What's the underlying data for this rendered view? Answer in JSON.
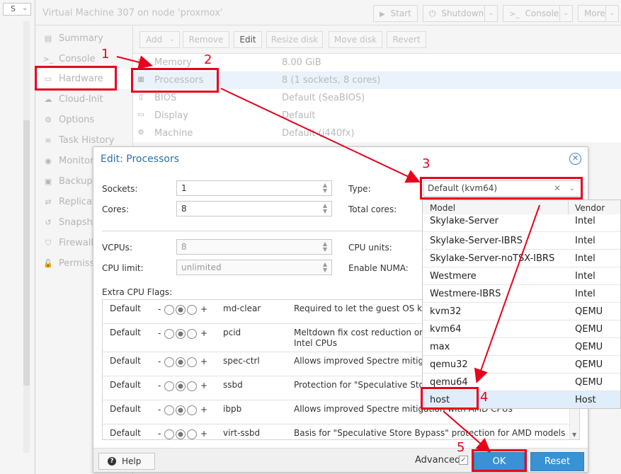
{
  "left_strip": {
    "select_value": "S",
    "select_caret": "⌄"
  },
  "header": {
    "title": "Virtual Machine 307 on node 'proxmox'",
    "buttons": [
      {
        "icon": "play-icon",
        "glyph": "▶",
        "label": "Start"
      },
      {
        "icon": "power-icon",
        "glyph": "⏻",
        "label": "Shutdown"
      },
      {
        "icon": "terminal-icon",
        "glyph": ">_",
        "label": "Console"
      },
      {
        "label": "More"
      }
    ]
  },
  "nav": {
    "items": [
      {
        "label": "Summary",
        "icon": "summary-icon",
        "glyph": "▤"
      },
      {
        "label": "Console",
        "icon": "terminal-icon",
        "glyph": ">_"
      },
      {
        "label": "Hardware",
        "icon": "monitor-icon",
        "glyph": "▭"
      },
      {
        "label": "Cloud-Init",
        "icon": "cloud-icon",
        "glyph": "☁"
      },
      {
        "label": "Options",
        "icon": "gear-icon",
        "glyph": "⚙"
      },
      {
        "label": "Task History",
        "icon": "list-icon",
        "glyph": "≡"
      },
      {
        "label": "Monitor",
        "icon": "eye-icon",
        "glyph": "◉"
      },
      {
        "label": "Backup",
        "icon": "floppy-icon",
        "glyph": "▣"
      },
      {
        "label": "Replicat",
        "icon": "retweet-icon",
        "glyph": "⇄"
      },
      {
        "label": "Snapsho",
        "icon": "history-icon",
        "glyph": "↺"
      },
      {
        "label": "Firewall",
        "icon": "shield-icon",
        "glyph": "⛉"
      },
      {
        "label": "Permiss",
        "icon": "unlock-icon",
        "glyph": "🔓"
      }
    ]
  },
  "toolbar": {
    "add_label": "Add",
    "remove_label": "Remove",
    "edit_label": "Edit",
    "resize_label": "Resize disk",
    "move_label": "Move disk",
    "revert_label": "Revert"
  },
  "hardware": [
    {
      "name": "Memory",
      "value": "8.00 GiB",
      "icon": "memory-icon",
      "glyph": "▥"
    },
    {
      "name": "Processors",
      "value": "8 (1 sockets, 8 cores)",
      "icon": "cpu-icon",
      "glyph": "▦"
    },
    {
      "name": "BIOS",
      "value": "Default (SeaBIOS)",
      "icon": "chip-icon",
      "glyph": "▯"
    },
    {
      "name": "Display",
      "value": "Default",
      "icon": "desktop-icon",
      "glyph": "▭"
    },
    {
      "name": "Machine",
      "value": "Default (i440fx)",
      "icon": "cogs-icon",
      "glyph": "⚙"
    }
  ],
  "dialog": {
    "title": "Edit: Processors",
    "close_glyph": "✕",
    "sockets_label": "Sockets:",
    "sockets_value": "1",
    "cores_label": "Cores:",
    "cores_value": "8",
    "type_label": "Type:",
    "type_value": "Default (kvm64)",
    "total_cores_label": "Total cores:",
    "vcpus_label": "VCPUs:",
    "vcpus_value": "8",
    "cpu_units_label": "CPU units:",
    "cpu_limit_label": "CPU limit:",
    "cpu_limit_value": "unlimited",
    "numa_label": "Enable NUMA:",
    "flags_label": "Extra CPU Flags:",
    "flags": [
      {
        "state": "Default",
        "name": "md-clear",
        "desc": "Required to let the guest OS kn"
      },
      {
        "state": "Default",
        "name": "pcid",
        "desc": "Meltdown fix cost reduction on V\nIntel CPUs"
      },
      {
        "state": "Default",
        "name": "spec-ctrl",
        "desc": "Allows improved Spectre mitiga"
      },
      {
        "state": "Default",
        "name": "ssbd",
        "desc": "Protection for \"Speculative Store"
      },
      {
        "state": "Default",
        "name": "ibpb",
        "desc": "Allows improved Spectre mitigation with AMD CPUs"
      },
      {
        "state": "Default",
        "name": "virt-ssbd",
        "desc": "Basis for \"Speculative Store Bypass\" protection for AMD models"
      }
    ],
    "tri_minus": "-",
    "tri_plus": "+",
    "help_label": "Help",
    "advanced_label": "Advanced",
    "advanced_check": "✓",
    "ok_label": "OK",
    "reset_label": "Reset"
  },
  "picker": {
    "col_model": "Model",
    "col_vendor": "Vendor",
    "rows": [
      {
        "model": "Skylake-Server",
        "vendor": "Intel"
      },
      {
        "model": "Skylake-Server-IBRS",
        "vendor": "Intel"
      },
      {
        "model": "Skylake-Server-noTSX-IBRS",
        "vendor": "Intel"
      },
      {
        "model": "Westmere",
        "vendor": "Intel"
      },
      {
        "model": "Westmere-IBRS",
        "vendor": "Intel"
      },
      {
        "model": "kvm32",
        "vendor": "QEMU"
      },
      {
        "model": "kvm64",
        "vendor": "QEMU"
      },
      {
        "model": "max",
        "vendor": "QEMU"
      },
      {
        "model": "qemu32",
        "vendor": "QEMU"
      },
      {
        "model": "qemu64",
        "vendor": "QEMU"
      },
      {
        "model": "host",
        "vendor": "Host"
      }
    ]
  },
  "annotations": {
    "n1": "1",
    "n2": "2",
    "n3": "3",
    "n4": "4",
    "n5": "5",
    "color": "#e8001c"
  }
}
